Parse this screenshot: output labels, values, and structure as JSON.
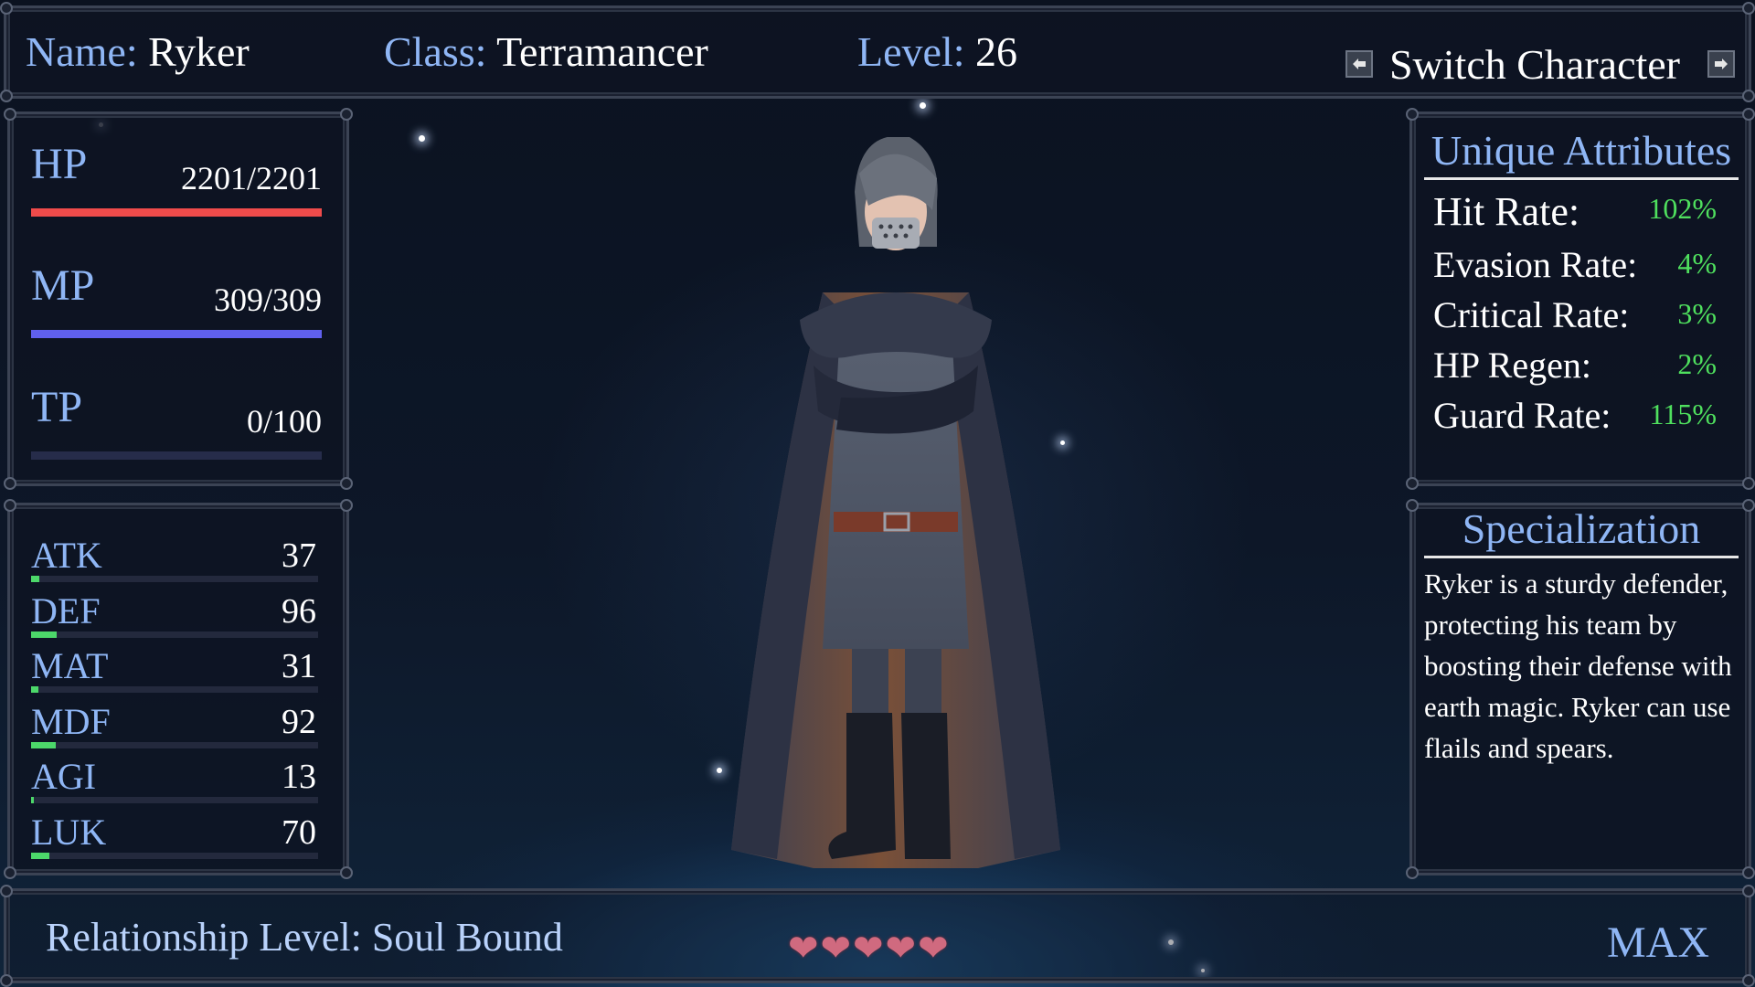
{
  "header": {
    "name_label": "Name:",
    "name_value": "Ryker",
    "class_label": "Class:",
    "class_value": "Terramancer",
    "level_label": "Level:",
    "level_value": "26",
    "switch_label": "Switch Character"
  },
  "resources": [
    {
      "label": "HP",
      "value": "2201/2201",
      "fill": 1.0,
      "color": "#ef4b4b"
    },
    {
      "label": "MP",
      "value": "309/309",
      "fill": 1.0,
      "color": "#6060ee"
    },
    {
      "label": "TP",
      "value": "0/100",
      "fill": 0.0,
      "color": "#4cd86a"
    }
  ],
  "stats": [
    {
      "label": "ATK",
      "value": "37",
      "fill": 0.03
    },
    {
      "label": "DEF",
      "value": "96",
      "fill": 0.09
    },
    {
      "label": "MAT",
      "value": "31",
      "fill": 0.025
    },
    {
      "label": "MDF",
      "value": "92",
      "fill": 0.085
    },
    {
      "label": "AGI",
      "value": "13",
      "fill": 0.01
    },
    {
      "label": "LUK",
      "value": "70",
      "fill": 0.065
    }
  ],
  "unique_attributes": {
    "title": "Unique Attributes",
    "items": [
      {
        "name": "Hit Rate:",
        "value": "102%"
      },
      {
        "name": "Evasion Rate:",
        "value": "4%"
      },
      {
        "name": "Critical Rate:",
        "value": "3%"
      },
      {
        "name": "HP Regen:",
        "value": "2%"
      },
      {
        "name": "Guard Rate:",
        "value": "115%"
      }
    ]
  },
  "specialization": {
    "title": "Specialization",
    "text": "Ryker is a sturdy defender, protecting his team by boosting their defense with earth magic. Ryker can use flails and spears."
  },
  "relationship": {
    "label": "Relationship Level: Soul Bound",
    "hearts": 5,
    "heart_glyph": "❤",
    "max_label": "MAX"
  },
  "colors": {
    "accent_label": "#8fb6f5",
    "value_green": "#4fe05e",
    "heart": "#d06a7f"
  }
}
